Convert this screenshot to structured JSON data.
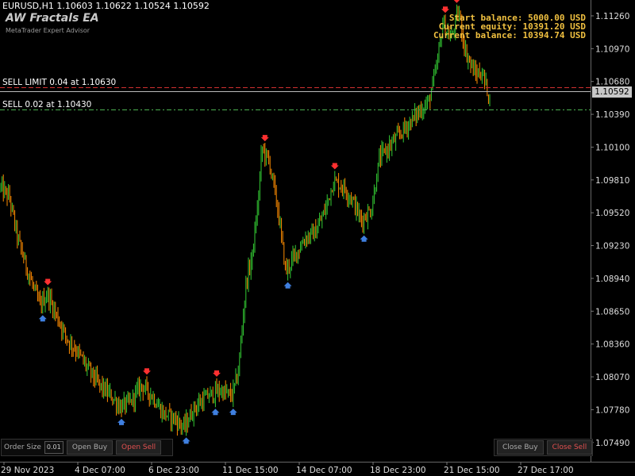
{
  "header": {
    "symbol_line": "EURUSD,H1  1.10603 1.10622 1.10524 1.10592",
    "ea_title": "AW Fractals EA",
    "ea_subtitle": "MetaTrader Expert Advisor"
  },
  "account": {
    "start_balance": "Start balance: 5000.00  USD",
    "current_equity": "Current equity: 10391.20  USD",
    "current_balance": "Current balance: 10394.74  USD"
  },
  "orders": {
    "sell_limit": "SELL LIMIT 0.04 at 1.10630",
    "sell": "SELL 0.02 at 1.10430"
  },
  "current_price": "1.10592",
  "panel_left": {
    "order_size_label": "Order Size",
    "order_size_value": "0.01",
    "open_buy": "Open Buy",
    "open_sell": "Open Sell"
  },
  "panel_right": {
    "close_buy": "Close Buy",
    "close_sell": "Close Sell"
  },
  "colors": {
    "background": "#000000",
    "candle_up": "#33cc33",
    "candle_down": "#ff8c00",
    "fractal_up": "#ff3030",
    "fractal_down": "#3f7fdf",
    "sell_limit_line": "#d03030",
    "sell_line": "#4caf50",
    "info_text": "#f0c040"
  },
  "chart_data": {
    "type": "candlestick",
    "symbol": "EURUSD",
    "timeframe": "H1",
    "y_ticks": [
      1.1126,
      1.1097,
      1.1068,
      1.1039,
      1.101,
      1.0981,
      1.0952,
      1.0923,
      1.0894,
      1.0865,
      1.0836,
      1.0807,
      1.0778,
      1.0749
    ],
    "ylim": [
      1.0732,
      1.114
    ],
    "x_ticks": [
      "29 Nov 2023",
      "4 Dec 07:00",
      "6 Dec 23:00",
      "11 Dec 15:00",
      "14 Dec 07:00",
      "18 Dec 23:00",
      "21 Dec 15:00",
      "27 Dec 17:00"
    ],
    "levels": {
      "sell_limit": 1.1063,
      "sell": 1.1043,
      "current": 1.10592
    },
    "price_path": [
      [
        0,
        1.0975
      ],
      [
        12,
        1.0965
      ],
      [
        22,
        1.093
      ],
      [
        35,
        1.09
      ],
      [
        50,
        1.087
      ],
      [
        60,
        1.088
      ],
      [
        72,
        1.086
      ],
      [
        85,
        1.084
      ],
      [
        97,
        1.083
      ],
      [
        110,
        1.0815
      ],
      [
        125,
        1.08
      ],
      [
        140,
        1.079
      ],
      [
        152,
        1.078
      ],
      [
        165,
        1.0785
      ],
      [
        178,
        1.08
      ],
      [
        192,
        1.079
      ],
      [
        205,
        1.0775
      ],
      [
        220,
        1.077
      ],
      [
        232,
        1.0762
      ],
      [
        245,
        1.078
      ],
      [
        262,
        1.079
      ],
      [
        278,
        1.0795
      ],
      [
        292,
        1.079
      ],
      [
        300,
        1.081
      ],
      [
        305,
        1.085
      ],
      [
        310,
        1.089
      ],
      [
        318,
        1.0915
      ],
      [
        325,
        1.096
      ],
      [
        330,
        1.101
      ],
      [
        340,
        1.0995
      ],
      [
        350,
        1.0955
      ],
      [
        360,
        1.09
      ],
      [
        372,
        1.0915
      ],
      [
        385,
        1.093
      ],
      [
        398,
        1.0935
      ],
      [
        410,
        1.0955
      ],
      [
        420,
        1.098
      ],
      [
        432,
        1.0975
      ],
      [
        443,
        1.0965
      ],
      [
        455,
        1.0945
      ],
      [
        468,
        1.0955
      ],
      [
        478,
        1.1
      ],
      [
        490,
        1.101
      ],
      [
        502,
        1.102
      ],
      [
        514,
        1.103
      ],
      [
        526,
        1.104
      ],
      [
        540,
        1.105
      ],
      [
        550,
        1.108
      ],
      [
        558,
        1.112
      ],
      [
        568,
        1.1105
      ],
      [
        578,
        1.113
      ],
      [
        586,
        1.1095
      ],
      [
        598,
        1.1075
      ],
      [
        608,
        1.1075
      ],
      [
        618,
        1.105
      ]
    ]
  }
}
